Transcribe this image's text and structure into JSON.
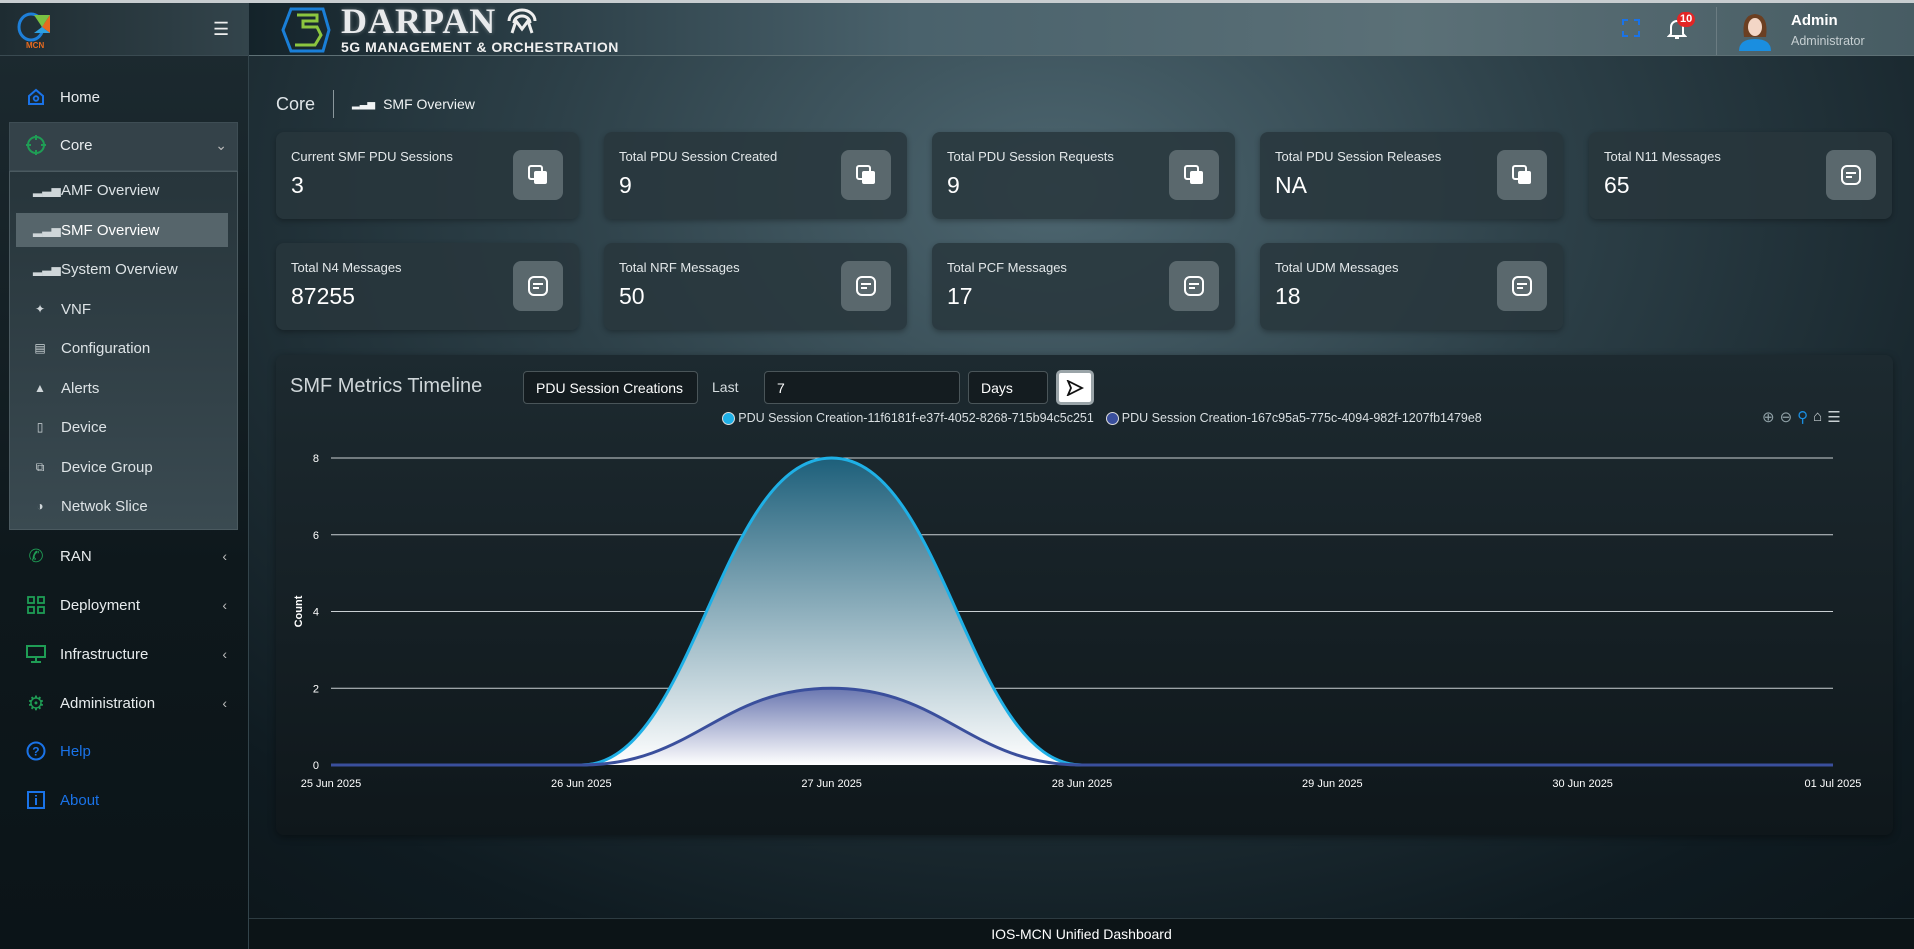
{
  "sidebar": {
    "logo_text": "IOS MCN",
    "items": [
      {
        "label": "Home",
        "icon": "home-icon"
      },
      {
        "label": "Core",
        "icon": "core-icon"
      },
      {
        "label": "RAN",
        "icon": "phone-signal-icon"
      },
      {
        "label": "Deployment",
        "icon": "grid-icon"
      },
      {
        "label": "Infrastructure",
        "icon": "monitor-icon"
      },
      {
        "label": "Administration",
        "icon": "gear-icon"
      },
      {
        "label": "Help",
        "icon": "help-icon"
      },
      {
        "label": "About",
        "icon": "info-icon"
      }
    ],
    "core_subitems": [
      {
        "label": "AMF Overview"
      },
      {
        "label": "SMF Overview"
      },
      {
        "label": "System Overview"
      },
      {
        "label": "VNF"
      },
      {
        "label": "Configuration"
      },
      {
        "label": "Alerts"
      },
      {
        "label": "Device"
      },
      {
        "label": "Device Group"
      },
      {
        "label": "Netwok Slice"
      }
    ]
  },
  "header": {
    "brand_title": "DARPAN",
    "brand_subtitle": "5G MANAGEMENT & ORCHESTRATION",
    "notification_count": "10",
    "user_name": "Admin",
    "user_role": "Administrator"
  },
  "breadcrumb": {
    "section": "Core",
    "page": "SMF Overview"
  },
  "cards": [
    {
      "label": "Current SMF PDU Sessions",
      "value": "3"
    },
    {
      "label": "Total PDU Session Created",
      "value": "9"
    },
    {
      "label": "Total PDU Session Requests",
      "value": "9"
    },
    {
      "label": "Total PDU Session Releases",
      "value": "NA"
    },
    {
      "label": "Total N11 Messages",
      "value": "65"
    },
    {
      "label": "Total N4 Messages",
      "value": "87255"
    },
    {
      "label": "Total NRF Messages",
      "value": "50"
    },
    {
      "label": "Total PCF Messages",
      "value": "17"
    },
    {
      "label": "Total UDM Messages",
      "value": "18"
    }
  ],
  "timeline": {
    "title": "SMF Metrics Timeline",
    "metric": "PDU Session Creations",
    "last_label": "Last",
    "last_value": "7",
    "unit": "Days"
  },
  "chart_data": {
    "type": "area",
    "ylabel": "Count",
    "xlabel": "",
    "ylim": [
      0,
      8
    ],
    "yticks": [
      "0",
      "2",
      "4",
      "6",
      "8"
    ],
    "categories": [
      "25 Jun 2025",
      "26 Jun 2025",
      "27 Jun 2025",
      "28 Jun 2025",
      "29 Jun 2025",
      "30 Jun 2025",
      "01 Jul 2025"
    ],
    "series": [
      {
        "name": "PDU Session Creation-11f6181f-e37f-4052-8268-715b94c5c251",
        "color": "#1fb0e6",
        "values": [
          0,
          0,
          8,
          0,
          0,
          0,
          0
        ]
      },
      {
        "name": "PDU Session Creation-167c95a5-775c-4094-982f-1207fb1479e8",
        "color": "#3a4f9c",
        "values": [
          0,
          0,
          2,
          0,
          0,
          0,
          0
        ]
      }
    ],
    "legend": "top-center",
    "grid": true
  },
  "footer": {
    "text": "IOS-MCN Unified Dashboard"
  }
}
